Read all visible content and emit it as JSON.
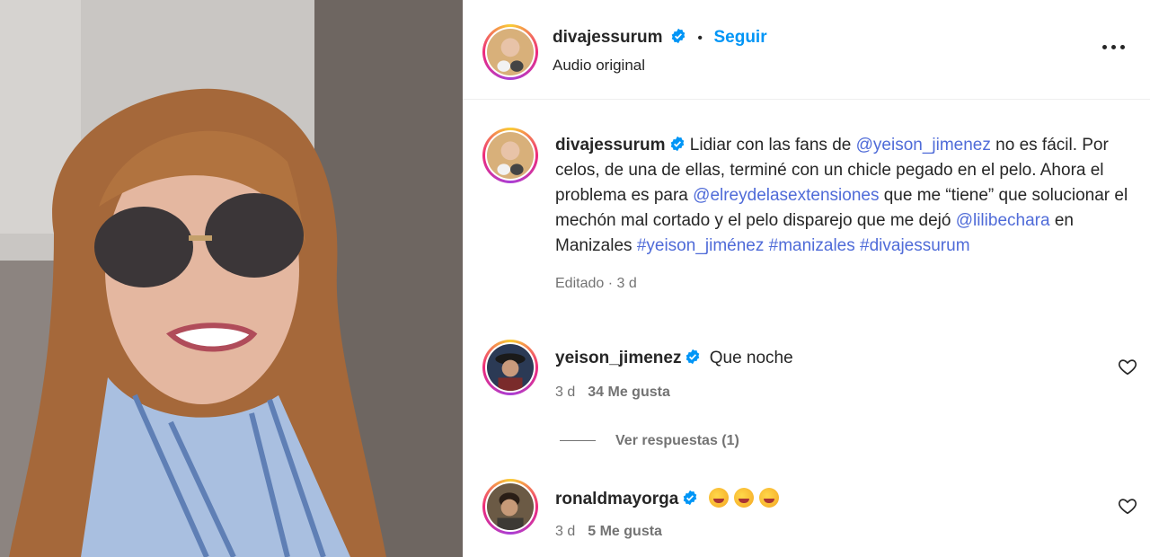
{
  "post": {
    "username": "divajessurum",
    "follow_label": "Seguir",
    "separator": "•",
    "audio": "Audio original"
  },
  "caption": {
    "username": "divajessurum",
    "t1": " Lidiar con las fans de ",
    "m1": "@yeison_jimenez",
    "t2": " no es fácil. Por celos, de una de ellas, terminé con un chicle pegado en el pelo. Ahora el problema es para ",
    "m2": "@elreydelasextensiones",
    "t3": " que me “tiene” que solucionar el mechón mal cortado y el pelo disparejo que me dejó ",
    "m3": "@lilibechara",
    "t4": " en Manizales ",
    "h1": "#yeison_jiménez",
    "h2": "#manizales",
    "h3": "#divajessurum",
    "meta": "Editado · 3 d"
  },
  "comments": [
    {
      "username": "yeison_jimenez",
      "text": "Que noche",
      "time": "3 d",
      "likes": "34 Me gusta"
    },
    {
      "username": "ronaldmayorga",
      "text": "",
      "emojis": [
        "rofl-emoji",
        "rofl-emoji",
        "rofl-emoji"
      ],
      "time": "3 d",
      "likes": "5 Me gusta"
    }
  ],
  "replies_label": "Ver respuestas (1)",
  "colors": {
    "accent": "#0095f6",
    "mention": "#4f6bd8",
    "muted": "#737373",
    "verified": "#0095f6"
  },
  "icons": {
    "verified": "verified-badge-icon",
    "more": "more-options-icon",
    "like": "heart-icon"
  }
}
